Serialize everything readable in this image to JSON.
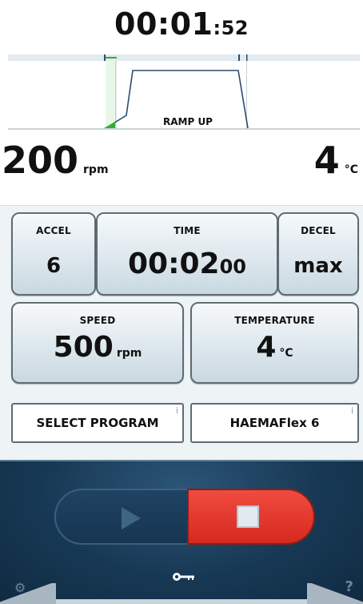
{
  "status": {
    "elapsed_main": "00:01",
    "elapsed_seconds": ":52",
    "phase_label": "RAMP UP",
    "current_speed": "200",
    "current_speed_unit": "rpm",
    "current_temp": "4",
    "current_temp_unit": "°C"
  },
  "settings": {
    "accel": {
      "label": "ACCEL",
      "value": "6"
    },
    "time": {
      "label": "TIME",
      "value_main": "00:02",
      "value_seconds": "00"
    },
    "decel": {
      "label": "DECEL",
      "value": "max"
    },
    "speed": {
      "label": "SPEED",
      "value": "500",
      "unit": "rpm"
    },
    "temperature": {
      "label": "TEMPERATURE",
      "value": "4",
      "unit": "°C"
    }
  },
  "program": {
    "select_label": "SELECT PROGRAM",
    "current_name": "HAEMAFlex 6",
    "info_glyph": "i"
  },
  "controls": {
    "start_icon": "play-icon",
    "stop_icon": "stop-icon",
    "lock_icon": "key-icon",
    "settings_icon": "gear-icon",
    "help_glyph": "?"
  },
  "colors": {
    "stop_red": "#e3342a",
    "panel_bg": "#eef3f6",
    "control_bg": "#173854",
    "progress_green": "#2fae2f"
  }
}
